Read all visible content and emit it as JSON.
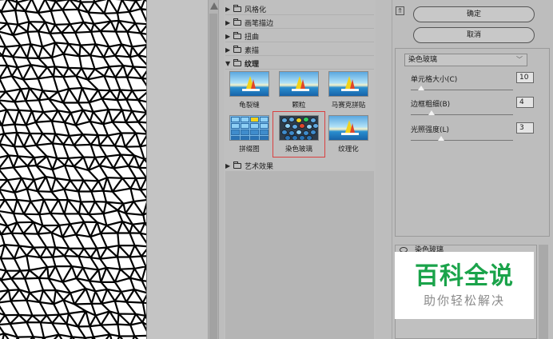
{
  "gallery": {
    "categories": [
      {
        "label": "风格化",
        "expanded": false
      },
      {
        "label": "画笔描边",
        "expanded": false
      },
      {
        "label": "扭曲",
        "expanded": false
      },
      {
        "label": "素描",
        "expanded": false
      },
      {
        "label": "纹理",
        "expanded": true
      },
      {
        "label": "艺术效果",
        "expanded": false
      }
    ],
    "texture_filters": [
      {
        "label": "龟裂缝",
        "selected": false
      },
      {
        "label": "颗粒",
        "selected": false
      },
      {
        "label": "马赛克拼贴",
        "selected": false
      },
      {
        "label": "拼缀图",
        "selected": false
      },
      {
        "label": "染色玻璃",
        "selected": true
      },
      {
        "label": "纹理化",
        "selected": false
      }
    ]
  },
  "panel": {
    "ok_label": "确定",
    "cancel_label": "取消",
    "filter_select_value": "染色玻璃",
    "params": [
      {
        "label": "单元格大小(C)",
        "value": "10",
        "level": 0.1
      },
      {
        "label": "边框粗细(B)",
        "value": "4",
        "level": 0.2
      },
      {
        "label": "光照强度(L)",
        "value": "3",
        "level": 0.3
      }
    ],
    "layer_name": "染色玻璃"
  },
  "watermark": {
    "title": "百科全说",
    "subtitle": "助你轻松解决"
  },
  "colors": {
    "selection_border": "#d94040",
    "watermark_green": "#1aa34a",
    "panel_bg": "#bdbdbd"
  }
}
